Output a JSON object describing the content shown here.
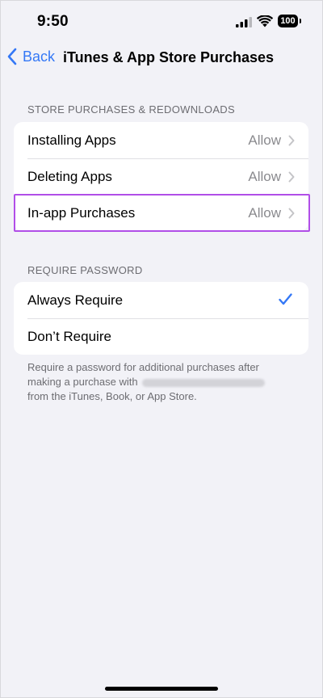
{
  "status_bar": {
    "time": "9:50",
    "battery": "100",
    "icons": [
      "signal-icon",
      "wifi-icon",
      "battery-icon"
    ]
  },
  "nav": {
    "back_label": "Back",
    "title": "iTunes & App Store Purchases"
  },
  "store_section": {
    "header": "STORE PURCHASES & REDOWNLOADS",
    "rows": [
      {
        "label": "Installing Apps",
        "value": "Allow"
      },
      {
        "label": "Deleting Apps",
        "value": "Allow"
      },
      {
        "label": "In-app Purchases",
        "value": "Allow"
      }
    ]
  },
  "password_section": {
    "header": "REQUIRE PASSWORD",
    "rows": [
      {
        "label": "Always Require",
        "selected": true
      },
      {
        "label": "Don’t Require",
        "selected": false
      }
    ]
  },
  "footer": {
    "line1": "Require a password for additional purchases after",
    "line2_prefix": "making a purchase with",
    "line3": "from the iTunes, Book, or App Store."
  },
  "colors": {
    "accent": "#3478f6",
    "highlight": "#b14ee8",
    "background": "#f2f2f7"
  }
}
